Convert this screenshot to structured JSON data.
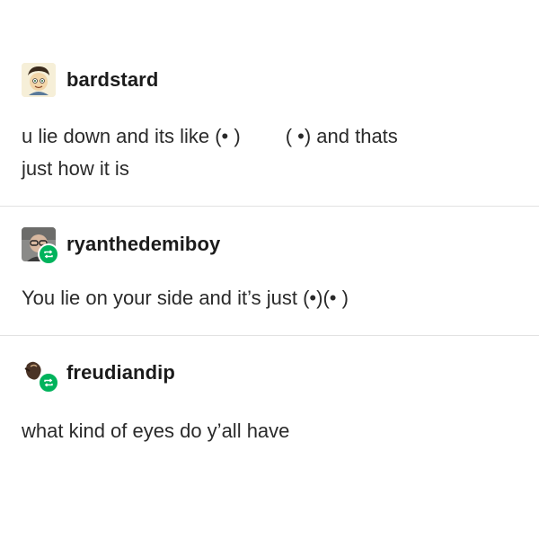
{
  "posts": [
    {
      "username": "bardstard",
      "avatar_icon": "cartoon-avatar-icon",
      "lines": [
        {
          "part1": "u lie down and its like (• )",
          "part2": "( •) and thats"
        },
        {
          "part1": "just how it is"
        }
      ]
    },
    {
      "username": "ryanthedemiboy",
      "avatar_icon": "photo-avatar-icon",
      "reblog_icon": "reblog-icon",
      "text": "You lie on your side and it’s just (•)(• )"
    },
    {
      "username": "freudiandip",
      "avatar_icon": "photo-avatar-icon",
      "reblog_icon": "reblog-icon",
      "text": "what kind of eyes do y’all have"
    }
  ],
  "colors": {
    "text": "#2a2a2a",
    "username": "#1b1b1b",
    "divider": "#e2e2e2",
    "reblog_badge": "#00b35c"
  }
}
